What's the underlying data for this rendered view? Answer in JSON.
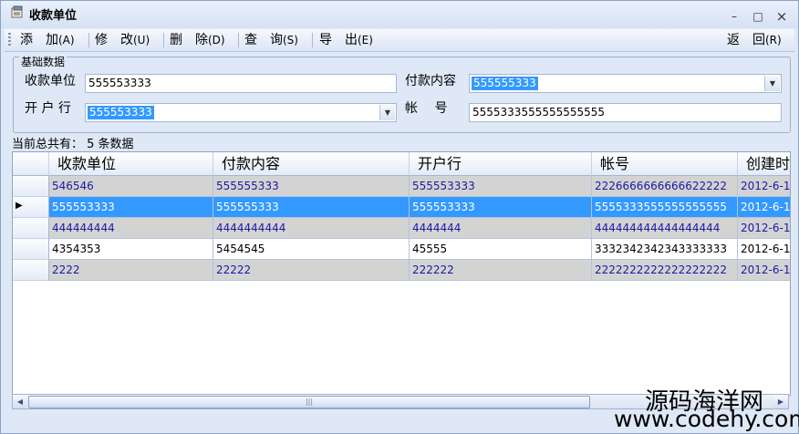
{
  "window": {
    "title": "收款单位",
    "minimize": "–",
    "maximize": "□",
    "close": "×"
  },
  "toolbar": [
    {
      "text": "添　加",
      "shortcut": "(A)"
    },
    {
      "text": "修　改",
      "shortcut": "(U)"
    },
    {
      "text": "删　除",
      "shortcut": "(D)"
    },
    {
      "text": "查　询",
      "shortcut": "(S)"
    },
    {
      "text": "导　出",
      "shortcut": "(E)"
    },
    {
      "text": "返　回",
      "shortcut": "(R)"
    }
  ],
  "form": {
    "group_title": "基础数据",
    "payee_label": "收款单位",
    "payee_value": "555553333",
    "content_label": "付款内容",
    "content_value": "555555333",
    "bank_label": "开 户 行",
    "bank_value": "555553333",
    "account_label": "帐　 号",
    "account_value": "5555333555555555555"
  },
  "status": {
    "count_text": "当前总共有： 5 条数据"
  },
  "grid": {
    "columns": [
      "收款单位",
      "付款内容",
      "开户行",
      "帐号",
      "创建时"
    ],
    "rows": [
      [
        "546546",
        "555555333",
        "555553333",
        "2226666666666622222",
        "2012-6-1"
      ],
      [
        "555553333",
        "555555333",
        "555553333",
        "5555333555555555555",
        "2012-6-1"
      ],
      [
        "444444444",
        "4444444444",
        "4444444",
        "444444444444444444",
        "2012-6-1"
      ],
      [
        "4354353",
        "5454545",
        "45555",
        "3332342342343333333",
        "2012-6-1"
      ],
      [
        "2222",
        "22222",
        "222222",
        "2222222222222222222",
        "2012-6-1"
      ]
    ],
    "selected_row": 1,
    "current_row_marker": "▶"
  },
  "scrollbar": {
    "left": "◀",
    "right": "▶",
    "grip": "|||"
  },
  "watermark": {
    "line1": "源码海洋网",
    "line2": "www.codehy.com"
  },
  "colors": {
    "selected_row": "#3399ff",
    "alt_row": "#d3d3d3",
    "odd_text": "#1a1aa6",
    "even_text": "#000000"
  }
}
